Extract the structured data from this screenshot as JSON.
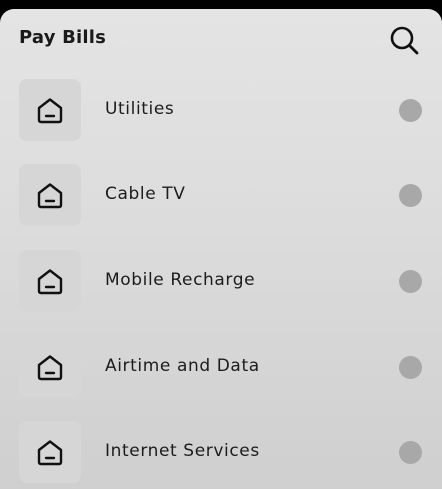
{
  "header": {
    "title": "Pay Bills",
    "search_icon": "search-icon"
  },
  "bills": {
    "items": [
      {
        "label": "Utilities",
        "icon": "home-icon"
      },
      {
        "label": "Cable TV",
        "icon": "home-icon"
      },
      {
        "label": "Mobile Recharge",
        "icon": "home-icon"
      },
      {
        "label": "Airtime and Data",
        "icon": "home-icon"
      },
      {
        "label": "Internet Services",
        "icon": "home-icon"
      }
    ]
  },
  "colors": {
    "background": "#dcdcdc",
    "tile": "#d6d6d6",
    "radio": "#a8a8a8",
    "text": "#1c1c1c"
  }
}
